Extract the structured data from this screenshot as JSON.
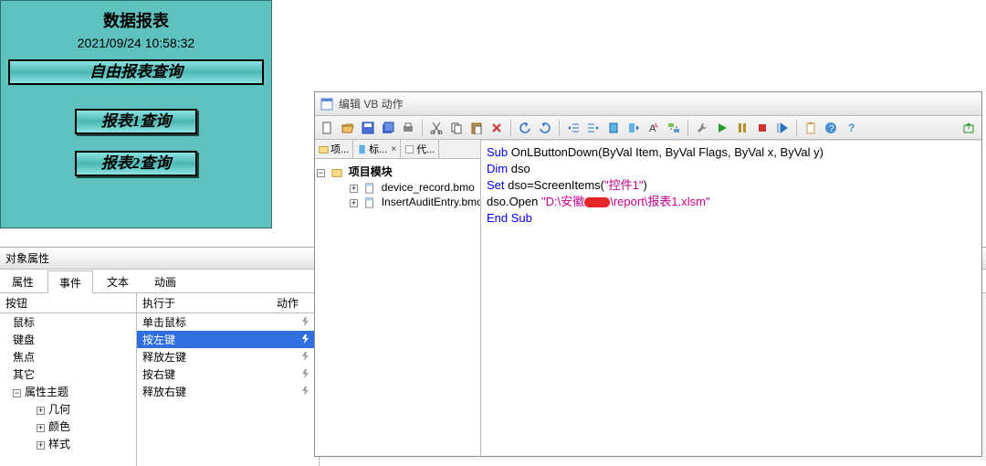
{
  "hmi": {
    "title": "数据报表",
    "timestamp": "2021/09/24 10:58:32",
    "btn_free": "自由报表查询",
    "btn_r1": "报表1查询",
    "btn_r2": "报表2查询"
  },
  "prop": {
    "panel_title": "对象属性",
    "tabs": {
      "t0": "属性",
      "t1": "事件",
      "t2": "文本",
      "t3": "动画"
    },
    "left_head": "按钮",
    "left_tree": {
      "mouse": "鼠标",
      "keyboard": "键盘",
      "focus": "焦点",
      "misc": "其它",
      "attr_theme": "属性主题",
      "geom": "几何",
      "color": "颜色",
      "style": "样式"
    },
    "mid_head_exec": "执行于",
    "mid_head_action": "动作",
    "events": {
      "e0": "单击鼠标",
      "e1": "按左键",
      "e2": "释放左键",
      "e3": "按右键",
      "e4": "释放右键"
    }
  },
  "vb": {
    "title": "编辑 VB 动作",
    "sidetabs": {
      "t0": "项...",
      "t1": "标...",
      "t2": "代..."
    },
    "tree_root": "项目模块",
    "tree_leaf0": "device_record.bmo",
    "tree_leaf1": "InsertAuditEntry.bmo",
    "toolbar": {
      "new": "new-icon",
      "open": "open-icon",
      "save": "save-icon",
      "saveall": "saveall-icon",
      "print": "print-icon",
      "cut": "cut-icon",
      "copy": "copy-icon",
      "paste": "paste-icon",
      "delete": "delete-icon",
      "undo": "undo-icon",
      "redo": "redo-icon",
      "indent": "indent-icon",
      "outdent": "outdent-icon",
      "bookmark": "bookmark-icon",
      "bookmark-next": "bookmark-next-icon",
      "text": "text-icon",
      "replace": "replace-icon",
      "tools": "wrench-icon",
      "run": "run-icon",
      "pause": "pause-icon",
      "stop": "stop-icon",
      "step": "step-icon",
      "help": "help-icon",
      "question": "question-icon",
      "export": "export-icon"
    },
    "code": {
      "l1_kw": "Sub ",
      "l1_rest": "OnLButtonDown(ByVal Item, ByVal Flags, ByVal x, ByVal y)",
      "l2_kw": "Dim ",
      "l2_rest": "dso",
      "l3_kw": "Set ",
      "l3_mid": "dso=ScreenItems(",
      "l3_str": "\"控件1\"",
      "l3_end": ")",
      "l4_pre": "dso.Open ",
      "l4_str1": "\"D:\\安徽",
      "l4_str2": "\\report\\报表1.xlsm\"",
      "l5": "End Sub"
    }
  }
}
